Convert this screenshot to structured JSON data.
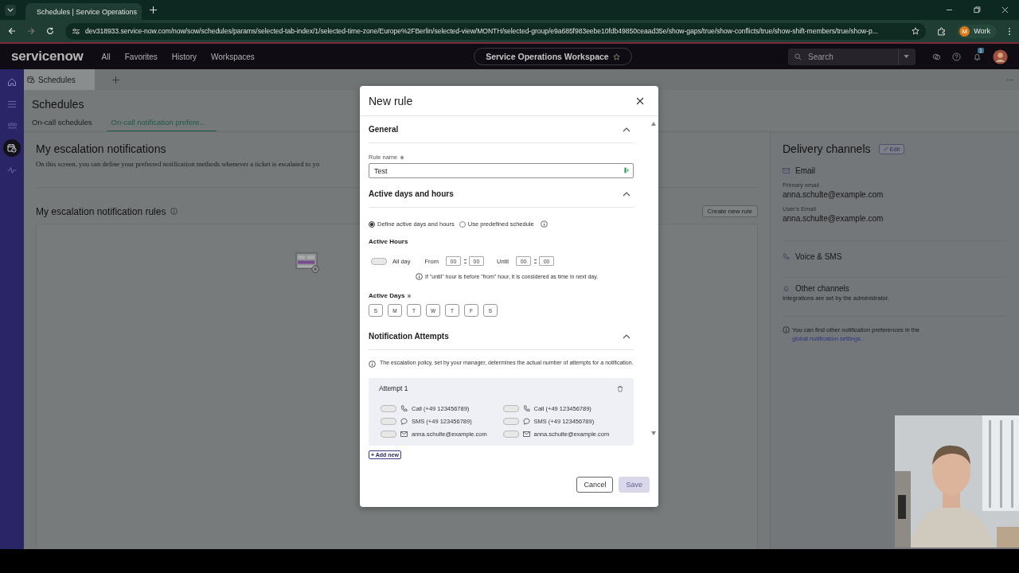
{
  "browser": {
    "tab_title": "Schedules | Service Operations",
    "url": "dev318933.service-now.com/now/sow/schedules/params/selected-tab-index/1/selected-time-zone/Europe%2FBerlin/selected-view/MONTH/selected-group/e9a685f983eebe10fdb49850ceaad35e/show-gaps/true/show-conflicts/true/show-shift-members/true/show-p...",
    "profile_initial": "M",
    "profile_label": "Work"
  },
  "header": {
    "logo": "servicenow",
    "nav": [
      "All",
      "Favorites",
      "History",
      "Workspaces"
    ],
    "workspace": "Service Operations Workspace",
    "search_placeholder": "Search",
    "notification_count": "1"
  },
  "app_tabs": [
    {
      "label": "Schedules",
      "selected": true
    }
  ],
  "page": {
    "title": "Schedules",
    "tabs": [
      {
        "label": "On-call schedules",
        "selected": false
      },
      {
        "label": "On-call notification prefere...",
        "selected": true
      }
    ],
    "heading": "My escalation notifications",
    "description": "On this screen, you can define your preferred notification methods whenever a ticket is escalated to yo",
    "rules_heading": "My escalation notification rules",
    "create_button": "Create new rule"
  },
  "delivery": {
    "title": "Delivery channels",
    "edit": "Edit",
    "email": {
      "title": "Email",
      "fields": [
        {
          "label": "Primary email",
          "value": "anna.schulte@example.com"
        },
        {
          "label": "User's Email",
          "value": "anna.schulte@example.com"
        }
      ]
    },
    "voice": {
      "title": "Voice & SMS"
    },
    "other": {
      "title": "Other channels",
      "note": "Integrations are set by the administrator."
    },
    "footer_note": "You can find other notification preferences in the",
    "footer_link": "global notification settings."
  },
  "modal": {
    "title": "New rule",
    "general": {
      "title": "General",
      "expanded": true,
      "rule_name_label": "Rule name",
      "required": true,
      "rule_name": "Test"
    },
    "active": {
      "title": "Active days and hours",
      "expanded": true,
      "options": [
        {
          "label": "Define active days and hours",
          "selected": true
        },
        {
          "label": "Use predefined schedule",
          "selected": false
        }
      ],
      "hours_label": "Active Hours",
      "all_day": {
        "label": "All day",
        "on": false
      },
      "from_label": "From",
      "from": [
        "00",
        "00"
      ],
      "until_label": "Until",
      "until": [
        "00",
        "00"
      ],
      "hint": "If \"until\" hour is before \"from\" hour, it is considered as time in next day.",
      "days_label": "Active Days",
      "days_required": true,
      "days": [
        {
          "label": "S",
          "selected": false
        },
        {
          "label": "M",
          "selected": false
        },
        {
          "label": "T",
          "selected": false
        },
        {
          "label": "W",
          "selected": false
        },
        {
          "label": "T",
          "selected": false
        },
        {
          "label": "F",
          "selected": false
        },
        {
          "label": "S",
          "selected": false
        }
      ]
    },
    "notifications": {
      "title": "Notification Attempts",
      "expanded": true,
      "info": "The escalation policy, set by your manager, determines the actual number of attempts for a notification.",
      "attempts": [
        {
          "title": "Attempt 1",
          "columns": [
            [
              {
                "kind": "call",
                "label": "Call (+49 123456789)",
                "on": false
              },
              {
                "kind": "sms",
                "label": "SMS (+49 123456789)",
                "on": false
              },
              {
                "kind": "email",
                "label": "anna.schulte@example.com",
                "on": false
              }
            ],
            [
              {
                "kind": "call",
                "label": "Call (+49 123456789)",
                "on": false
              },
              {
                "kind": "sms",
                "label": "SMS (+49 123456789)",
                "on": false
              },
              {
                "kind": "email",
                "label": "anna.schulte@example.com",
                "on": false
              }
            ]
          ]
        }
      ],
      "add_new": "+ Add new"
    },
    "cancel": "Cancel",
    "save": {
      "label": "Save",
      "disabled": true
    }
  }
}
